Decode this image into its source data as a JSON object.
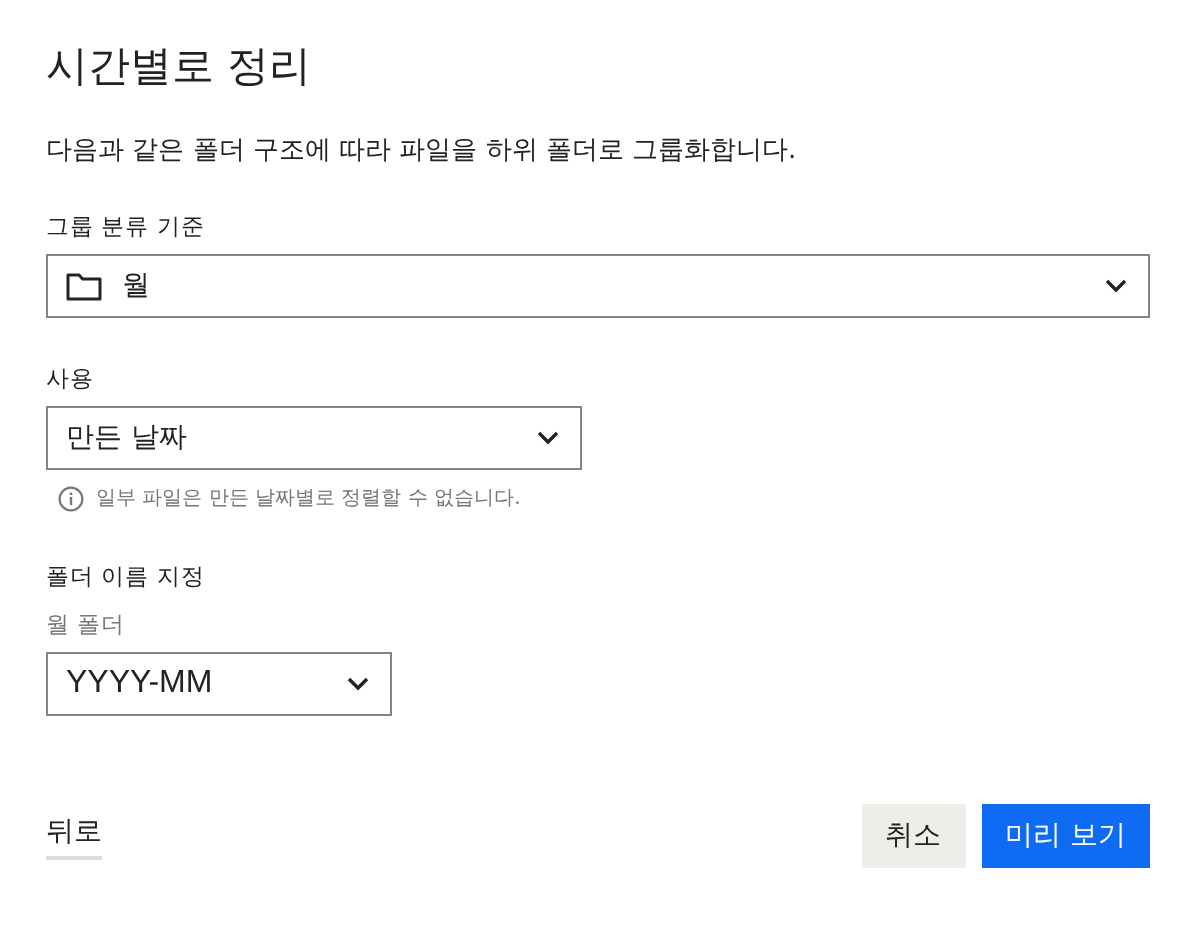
{
  "title": "시간별로 정리",
  "description": "다음과 같은 폴더 구조에 따라 파일을 하위 폴더로 그룹화합니다.",
  "group_by": {
    "label": "그룹 분류 기준",
    "value": "월"
  },
  "use": {
    "label": "사용",
    "value": "만든 날짜",
    "note": "일부 파일은 만든 날짜별로 정렬할 수 없습니다."
  },
  "folder_naming": {
    "label": "폴더 이름 지정",
    "sublabel": "월 폴더",
    "value": "YYYY-MM"
  },
  "footer": {
    "back": "뒤로",
    "buttons": [
      {
        "label": "취소",
        "kind": "secondary"
      },
      {
        "label": "미리 보기",
        "kind": "primary"
      }
    ]
  }
}
